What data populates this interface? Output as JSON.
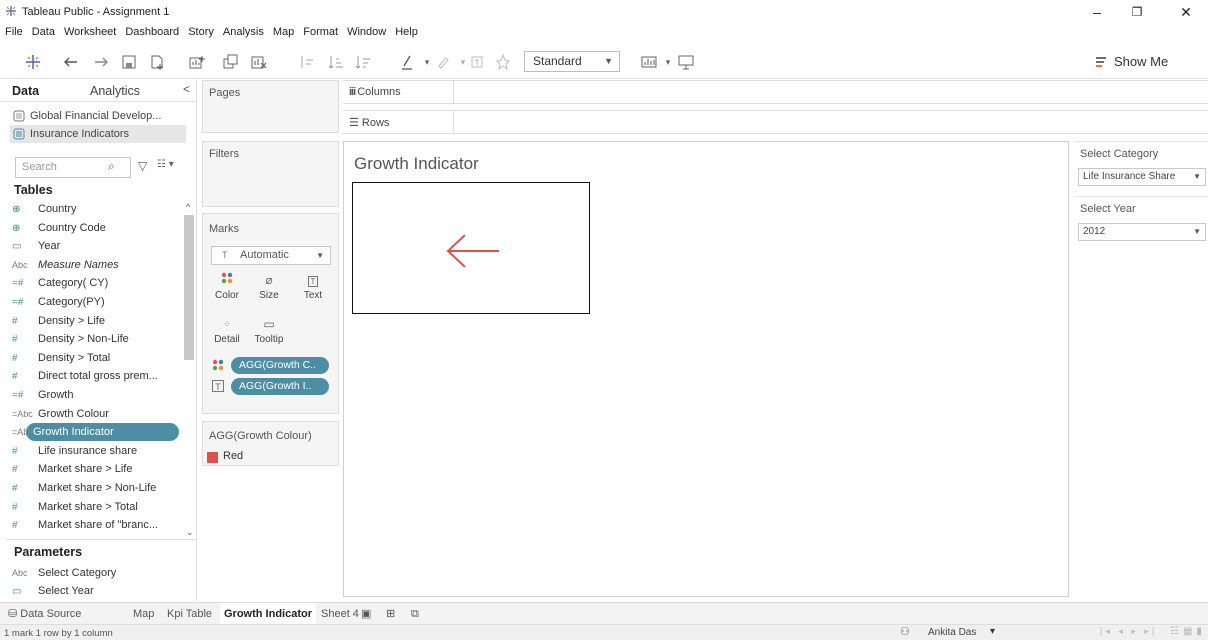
{
  "window": {
    "title": "Tableau Public - Assignment 1",
    "controls": [
      "–",
      "❐",
      "✕"
    ]
  },
  "menu": [
    "File",
    "Data",
    "Worksheet",
    "Dashboard",
    "Story",
    "Analysis",
    "Map",
    "Format",
    "Window",
    "Help"
  ],
  "toolbar": {
    "fit_select": "Standard",
    "show_me": "Show Me"
  },
  "data_pane": {
    "tab_data": "Data",
    "tab_analytics": "Analytics",
    "collapse_glyph": "<",
    "datasources": [
      "Global Financial Develop...",
      "Insurance Indicators"
    ],
    "search_placeholder": "Search",
    "tables_heading": "Tables",
    "fields": [
      {
        "icon": "⊕",
        "name": "Country",
        "italic": false
      },
      {
        "icon": "⊕",
        "name": "Country Code",
        "italic": false
      },
      {
        "icon": "▭",
        "name": "Year",
        "italic": false
      },
      {
        "icon": "Abc",
        "name": "Measure Names",
        "italic": true
      },
      {
        "icon": "=#",
        "name": "Category( CY)",
        "italic": false
      },
      {
        "icon": "=#",
        "name": "Category(PY)",
        "italic": false
      },
      {
        "icon": "#",
        "name": "Density > Life",
        "italic": false
      },
      {
        "icon": "#",
        "name": "Density > Non-Life",
        "italic": false
      },
      {
        "icon": "#",
        "name": "Density > Total",
        "italic": false
      },
      {
        "icon": "#",
        "name": "Direct total gross prem...",
        "italic": false
      },
      {
        "icon": "=#",
        "name": "Growth",
        "italic": false
      },
      {
        "icon": "=Abc",
        "name": "Growth Colour",
        "italic": false
      },
      {
        "icon": "=Abc",
        "name": "Growth Indicator",
        "italic": false
      },
      {
        "icon": "#",
        "name": "Life insurance share",
        "italic": false
      },
      {
        "icon": "#",
        "name": "Market share > Life",
        "italic": false
      },
      {
        "icon": "#",
        "name": "Market share > Non-Life",
        "italic": false
      },
      {
        "icon": "#",
        "name": "Market share > Total",
        "italic": false
      },
      {
        "icon": "#",
        "name": "Market share of \"branc...",
        "italic": false
      }
    ],
    "selected_field": "Growth Indicator",
    "parameters_heading": "Parameters",
    "parameters": [
      {
        "icon": "Abc",
        "name": "Select Category"
      },
      {
        "icon": "▭",
        "name": "Select Year"
      }
    ]
  },
  "shelves": {
    "pages": "Pages",
    "filters": "Filters",
    "columns": "Columns",
    "rows": "Rows"
  },
  "marks": {
    "title": "Marks",
    "mark_type": "Automatic",
    "buttons": [
      "Color",
      "Size",
      "Text",
      "Detail",
      "Tooltip"
    ],
    "pills": [
      "AGG(Growth C..",
      "AGG(Growth I.."
    ]
  },
  "legend": {
    "title": "AGG(Growth Colour)",
    "items": [
      {
        "label": "Red",
        "color": "#d9534f"
      }
    ]
  },
  "viz": {
    "title": "Growth Indicator",
    "arrow_color": "#d9534f"
  },
  "filters_right": [
    {
      "title": "Select Category",
      "value": "Life Insurance Share"
    },
    {
      "title": "Select Year",
      "value": "2012"
    }
  ],
  "sheet_tabs": [
    "Data Source",
    "Map",
    "Kpi Table",
    "Growth Indicator",
    "Sheet 4"
  ],
  "active_tab": "Growth Indicator",
  "status": {
    "summary": "1 mark    1 row by 1 column",
    "user": "Ankita Das"
  }
}
